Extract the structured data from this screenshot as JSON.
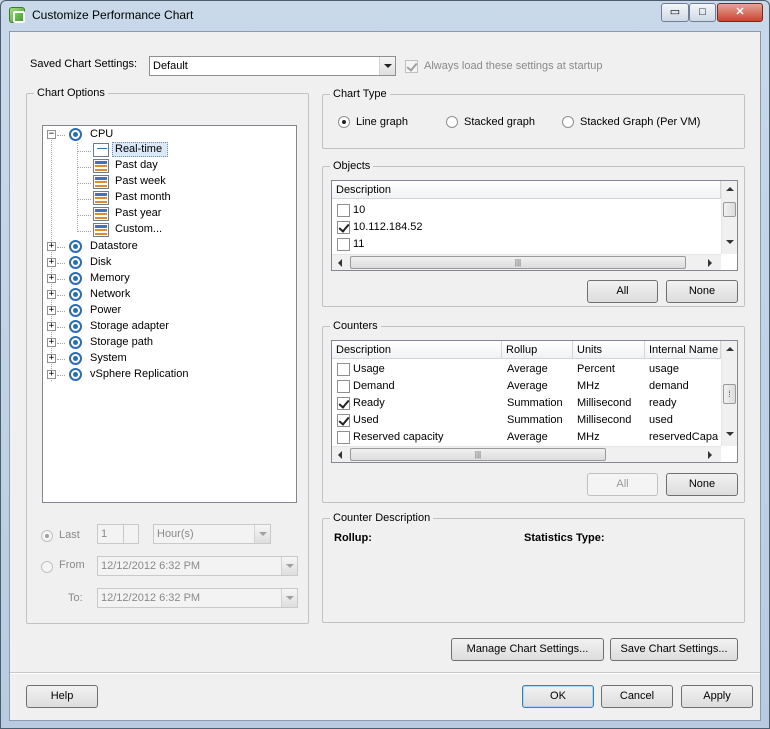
{
  "window": {
    "title": "Customize Performance Chart",
    "controls": {
      "minimize": "▭",
      "maximize": "□",
      "close": "✕"
    }
  },
  "saved_settings": {
    "label": "Saved Chart Settings:",
    "value": "Default",
    "always_load_label": "Always load these settings at startup",
    "always_load_checked": true
  },
  "chart_options": {
    "title": "Chart Options",
    "tree": [
      {
        "label": "CPU",
        "expanded": true,
        "icon": "counter-group-icon",
        "children": [
          {
            "label": "Real-time",
            "icon": "line-chart-icon",
            "selected": true
          },
          {
            "label": "Past day",
            "icon": "bar-chart-icon"
          },
          {
            "label": "Past week",
            "icon": "bar-chart-icon"
          },
          {
            "label": "Past month",
            "icon": "bar-chart-icon"
          },
          {
            "label": "Past year",
            "icon": "bar-chart-icon"
          },
          {
            "label": "Custom...",
            "icon": "bar-chart-icon"
          }
        ]
      },
      {
        "label": "Datastore",
        "expanded": false,
        "icon": "counter-group-icon"
      },
      {
        "label": "Disk",
        "expanded": false,
        "icon": "counter-group-icon"
      },
      {
        "label": "Memory",
        "expanded": false,
        "icon": "counter-group-icon"
      },
      {
        "label": "Network",
        "expanded": false,
        "icon": "counter-group-icon"
      },
      {
        "label": "Power",
        "expanded": false,
        "icon": "counter-group-icon"
      },
      {
        "label": "Storage adapter",
        "expanded": false,
        "icon": "counter-group-icon"
      },
      {
        "label": "Storage path",
        "expanded": false,
        "icon": "counter-group-icon"
      },
      {
        "label": "System",
        "expanded": false,
        "icon": "counter-group-icon"
      },
      {
        "label": "vSphere Replication",
        "expanded": false,
        "icon": "counter-group-icon"
      }
    ],
    "expand_symbol": "+",
    "collapse_symbol": "−",
    "last_label": "Last",
    "last_value": "1",
    "last_unit": "Hour(s)",
    "from_label": "From",
    "from_value": "12/12/2012   6:32 PM",
    "to_label": "To:",
    "to_value": "12/12/2012   6:32 PM"
  },
  "chart_type": {
    "title": "Chart Type",
    "options": [
      {
        "label": "Line graph",
        "selected": true
      },
      {
        "label": "Stacked graph",
        "selected": false
      },
      {
        "label": "Stacked Graph (Per VM)",
        "selected": false
      }
    ]
  },
  "objects": {
    "title": "Objects",
    "header": "Description",
    "rows": [
      {
        "label": "10",
        "checked": false
      },
      {
        "label": "10.112.184.52",
        "checked": true
      },
      {
        "label": "11",
        "checked": false
      }
    ],
    "all_label": "All",
    "none_label": "None"
  },
  "counters": {
    "title": "Counters",
    "headers": [
      "Description",
      "Rollup",
      "Units",
      "Internal Name"
    ],
    "rows": [
      {
        "checked": false,
        "cells": [
          "Usage",
          "Average",
          "Percent",
          "usage"
        ]
      },
      {
        "checked": false,
        "cells": [
          "Demand",
          "Average",
          "MHz",
          "demand"
        ]
      },
      {
        "checked": true,
        "cells": [
          "Ready",
          "Summation",
          "Millisecond",
          "ready"
        ]
      },
      {
        "checked": true,
        "cells": [
          "Used",
          "Summation",
          "Millisecond",
          "used"
        ]
      },
      {
        "checked": false,
        "cells": [
          "Reserved capacity",
          "Average",
          "MHz",
          "reservedCapa"
        ]
      }
    ],
    "all_label": "All",
    "none_label": "None"
  },
  "counter_description": {
    "title": "Counter Description",
    "rollup_label": "Rollup:",
    "stats_type_label": "Statistics Type:"
  },
  "buttons": {
    "manage": "Manage Chart Settings...",
    "save": "Save Chart Settings...",
    "help": "Help",
    "ok": "OK",
    "cancel": "Cancel",
    "apply": "Apply"
  },
  "scroll_glyphs": {
    "grip": "⁞",
    "hgrip": "|||"
  }
}
